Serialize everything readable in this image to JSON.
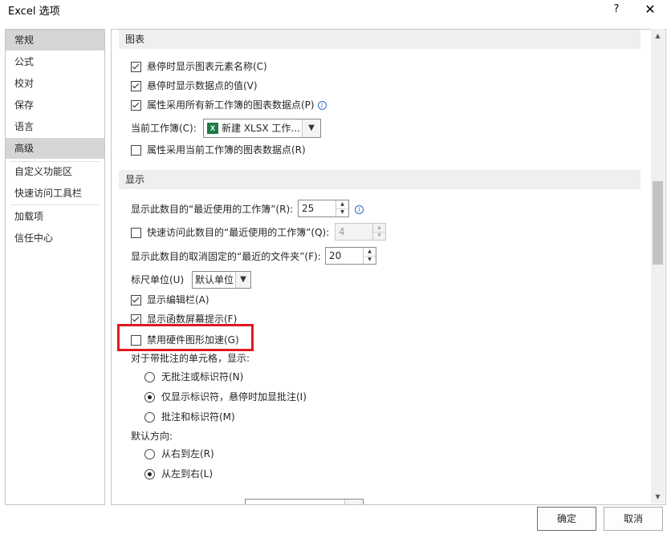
{
  "window": {
    "title": "Excel 选项",
    "help_label": "?",
    "close_label": "✕"
  },
  "sidebar": {
    "items": [
      {
        "label": "常规",
        "selected": true
      },
      {
        "label": "公式"
      },
      {
        "label": "校对"
      },
      {
        "label": "保存"
      },
      {
        "label": "语言"
      },
      {
        "label": "高级",
        "selected": true
      },
      {
        "label": "自定义功能区"
      },
      {
        "label": "快速访问工具栏"
      },
      {
        "label": "加载项"
      },
      {
        "label": "信任中心"
      }
    ]
  },
  "chart_section": {
    "header": "图表",
    "show_element_names": {
      "label": "悬停时显示图表元素名称(C)",
      "checked": true
    },
    "show_data_values": {
      "label": "悬停时显示数据点的值(V)",
      "checked": true
    },
    "properties_follow_all": {
      "label": "属性采用所有新工作簿的图表数据点(P)",
      "checked": true
    },
    "current_workbook_label": "当前工作簿(C):",
    "current_workbook_value": "新建 XLSX 工作...",
    "properties_follow_current": {
      "label": "属性采用当前工作簿的图表数据点(R)",
      "checked": false
    }
  },
  "display_section": {
    "header": "显示",
    "recent_workbooks": {
      "label": "显示此数目的“最近使用的工作簿”(R):",
      "value": "25"
    },
    "quick_access_recent": {
      "label": "快速访问此数目的“最近使用的工作簿”(Q):",
      "value": "4",
      "checked": false
    },
    "unpinned_folders": {
      "label": "显示此数目的取消固定的“最近的文件夹”(F):",
      "value": "20"
    },
    "ruler_units_label": "标尺单位(U)",
    "ruler_units_value": "默认单位",
    "show_formula_bar": {
      "label": "显示编辑栏(A)",
      "checked": true
    },
    "show_function_tips": {
      "label": "显示函数屏幕提示(F)",
      "checked": true
    },
    "disable_hw_accel": {
      "label": "禁用硬件图形加速(G)",
      "checked": false
    },
    "comments_label": "对于带批注的单元格，显示:",
    "comments_options": [
      {
        "label": "无批注或标识符(N)",
        "selected": false
      },
      {
        "label": "仅显示标识符，悬停时加显批注(I)",
        "selected": true
      },
      {
        "label": "批注和标识符(M)",
        "selected": false
      }
    ],
    "direction_label": "默认方向:",
    "direction_options": [
      {
        "label": "从右到左(R)",
        "selected": false
      },
      {
        "label": "从左到右(L)",
        "selected": true
      }
    ]
  },
  "footer": {
    "ok_label": "确定",
    "cancel_label": "取消"
  },
  "colors": {
    "highlight_border": "#e0191f",
    "excel_green": "#1f7a45",
    "info_blue": "#2b6cc4"
  },
  "icons": {
    "excel": "excel-file-icon",
    "info": "info-icon",
    "dropdown": "chevron-down-icon",
    "spin_up": "spin-up-icon",
    "spin_down": "spin-down-icon"
  }
}
